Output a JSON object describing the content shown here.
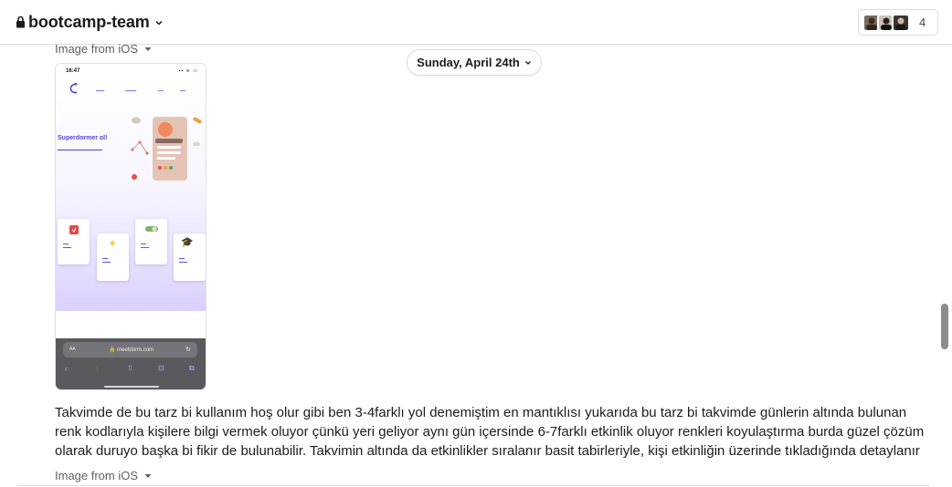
{
  "header": {
    "channel_name": "bootcamp-team",
    "member_count": "4"
  },
  "messages": {
    "image_label_top": "Image from iOS",
    "date_divider": "Sunday, April 24th",
    "text": "Takvimde de bu tarz bi kullanım hoş olur gibi ben 3-4farklı yol denemiştim en mantıklısı yukarıda bu tarz bi takvimde günlerin altında bulunan renk kodlarıyla kişilere bilgi vermek oluyor çünkü yeri geliyor aynı gün içersinde 6-7farklı etkinlik oluyor renkleri koyulaştırma burda güzel çözüm olarak duruyo başka bi fikir de bulunabilir. Takvimin altında da etkinlikler sıralanır basit tabirleriyle, kişi etkinliğin üzerinde tıkladığında detaylanır",
    "image_label_bottom": "Image from iOS"
  },
  "screenshot": {
    "time": "16:47",
    "hero_title": "Superdormer ol!",
    "url": "meetdorm.com",
    "url_aa": "AA"
  },
  "colors": {
    "accent_purple": "#5b3fd9",
    "text": "#1d1c1d",
    "muted": "#616061",
    "border": "#dddddd"
  },
  "icons": {
    "lock": "lock-icon",
    "chevron": "chevron-down-icon",
    "caret": "caret-down-icon"
  }
}
